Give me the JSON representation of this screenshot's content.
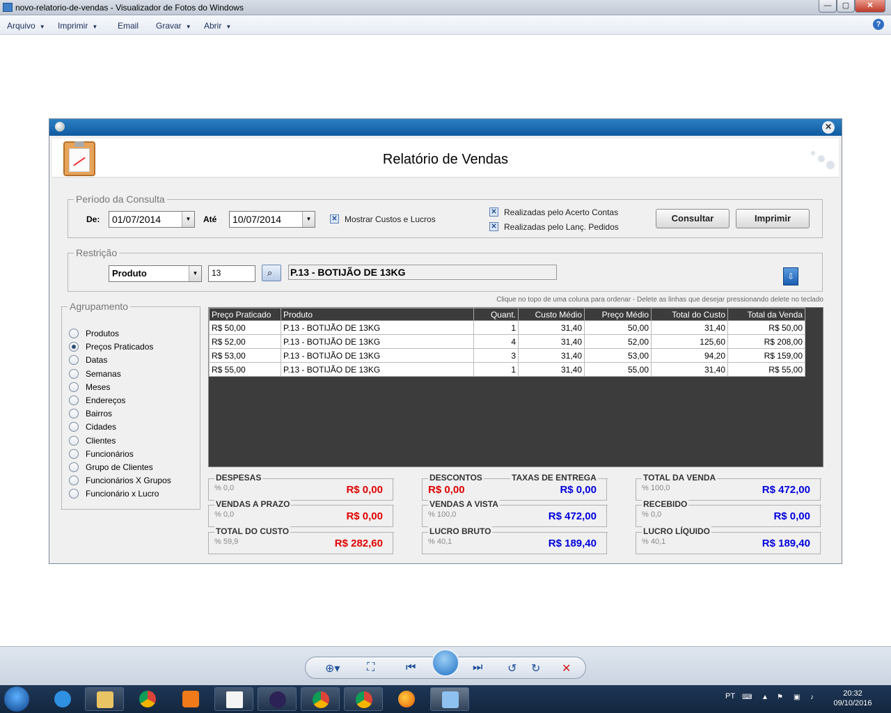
{
  "window": {
    "title": "novo-relatorio-de-vendas - Visualizador de Fotos do Windows"
  },
  "menu": [
    {
      "label": "Arquivo",
      "has_arrow": true
    },
    {
      "label": "Imprimir",
      "has_arrow": true
    },
    {
      "label": "Email",
      "has_arrow": false
    },
    {
      "label": "Gravar",
      "has_arrow": true
    },
    {
      "label": "Abrir",
      "has_arrow": true
    }
  ],
  "report": {
    "title": "Relatório de Vendas",
    "periodo": {
      "legend": "Período da Consulta",
      "de_label": "De:",
      "de_value": "01/07/2014",
      "ate_label": "Até",
      "ate_value": "10/07/2014",
      "mostrar_custos": "Mostrar Custos e Lucros",
      "acerto_contas": "Realizadas pelo Acerto Contas",
      "lanc_pedidos": "Realizadas pelo Lanç. Pedidos",
      "consultar": "Consultar",
      "imprimir": "Imprimir"
    },
    "restricao": {
      "legend": "Restrição",
      "type": "Produto",
      "code": "13",
      "product_name": "P.13 - BOTIJÃO DE 13KG"
    },
    "agrupamento": {
      "legend": "Agrupamento",
      "selected_index": 1,
      "options": [
        "Produtos",
        "Preços Praticados",
        "Datas",
        "Semanas",
        "Meses",
        "Endereços",
        "Bairros",
        "Cidades",
        "Clientes",
        "Funcionários",
        "Grupo de Clientes",
        "Funcionários X Grupos",
        "Funcionário x Lucro"
      ]
    },
    "grid": {
      "hint": "Clique no topo de uma coluna para ordenar - Delete as linhas que desejar pressionando delete no teclado",
      "columns": [
        "Preço Praticado",
        "Produto",
        "Quant.",
        "Custo Médio",
        "Preço Médio",
        "Total do Custo",
        "Total da Venda"
      ],
      "rows": [
        [
          "R$ 50,00",
          "P.13 - BOTIJÃO DE 13KG",
          "1",
          "31,40",
          "50,00",
          "31,40",
          "R$ 50,00"
        ],
        [
          "R$ 52,00",
          "P.13 - BOTIJÃO DE 13KG",
          "4",
          "31,40",
          "52,00",
          "125,60",
          "R$ 208,00"
        ],
        [
          "R$ 53,00",
          "P.13 - BOTIJÃO DE 13KG",
          "3",
          "31,40",
          "53,00",
          "94,20",
          "R$ 159,00"
        ],
        [
          "R$ 55,00",
          "P.13 - BOTIJÃO DE 13KG",
          "1",
          "31,40",
          "55,00",
          "31,40",
          "R$ 55,00"
        ]
      ]
    },
    "summary": {
      "despesas": {
        "label": "DESPESAS",
        "pct": "% 0,0",
        "value": "R$ 0,00"
      },
      "vendas_prazo": {
        "label": "VENDAS A PRAZO",
        "pct": "% 0,0",
        "value": "R$ 0,00"
      },
      "total_custo": {
        "label": "TOTAL DO CUSTO",
        "pct": "% 59,9",
        "value": "R$ 282,60"
      },
      "descontos": {
        "label": "DESCONTOS",
        "value": "R$ 0,00"
      },
      "taxas_entrega": {
        "label": "TAXAS DE ENTREGA",
        "value": "R$ 0,00"
      },
      "vendas_vista": {
        "label": "VENDAS A VISTA",
        "pct": "% 100,0",
        "value": "R$ 472,00"
      },
      "lucro_bruto": {
        "label": "LUCRO BRUTO",
        "pct": "% 40,1",
        "value": "R$ 189,40"
      },
      "total_venda": {
        "label": "TOTAL DA VENDA",
        "pct": "% 100,0",
        "value": "R$ 472,00"
      },
      "recebido": {
        "label": "RECEBIDO",
        "pct": "% 0,0",
        "value": "R$ 0,00"
      },
      "lucro_liquido": {
        "label": "LUCRO LÍQUIDO",
        "pct": "% 40,1",
        "value": "R$ 189,40"
      }
    }
  },
  "colors": {
    "red": "#e00000",
    "blue": "#0000dd",
    "accent": "#1a66b0"
  },
  "taskbar": {
    "lang": "PT",
    "time": "20:32",
    "date": "09/10/2016"
  }
}
